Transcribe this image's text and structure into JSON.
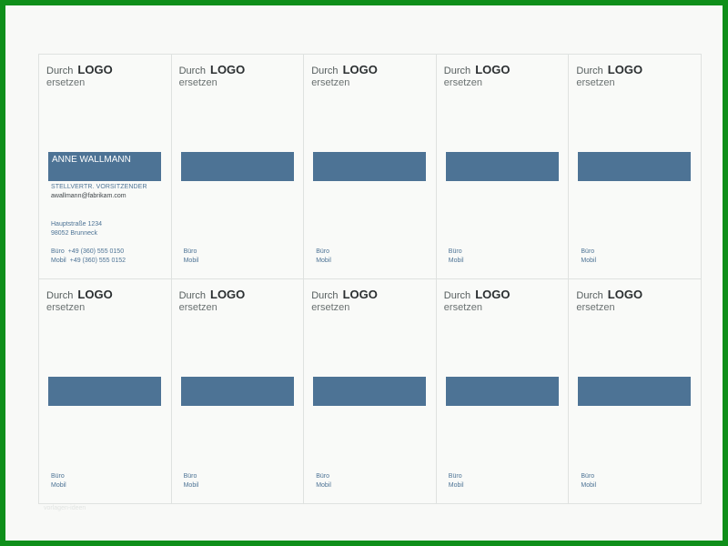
{
  "logo": {
    "prefix": "Durch",
    "brand": "LOGO",
    "suffix": "ersetzen"
  },
  "card_main": {
    "name": "ANNE WALLMANN",
    "title": "STELLVERTR. VORSITZENDER",
    "email": "awallmann@fabrikam.com",
    "street": "Hauptstraße 1234",
    "city": "98052 Brunneck",
    "office_label": "Büro",
    "office_number": "+49 (360) 555 0150",
    "mobile_label": "Mobil",
    "mobile_number": "+49 (360) 555 0152"
  },
  "card_blank": {
    "office_label": "Büro",
    "mobile_label": "Mobil"
  },
  "footer": {
    "note": "vorlagen-ideen"
  },
  "colors": {
    "frame": "#0f8f1a",
    "accent": "#4d7395"
  }
}
